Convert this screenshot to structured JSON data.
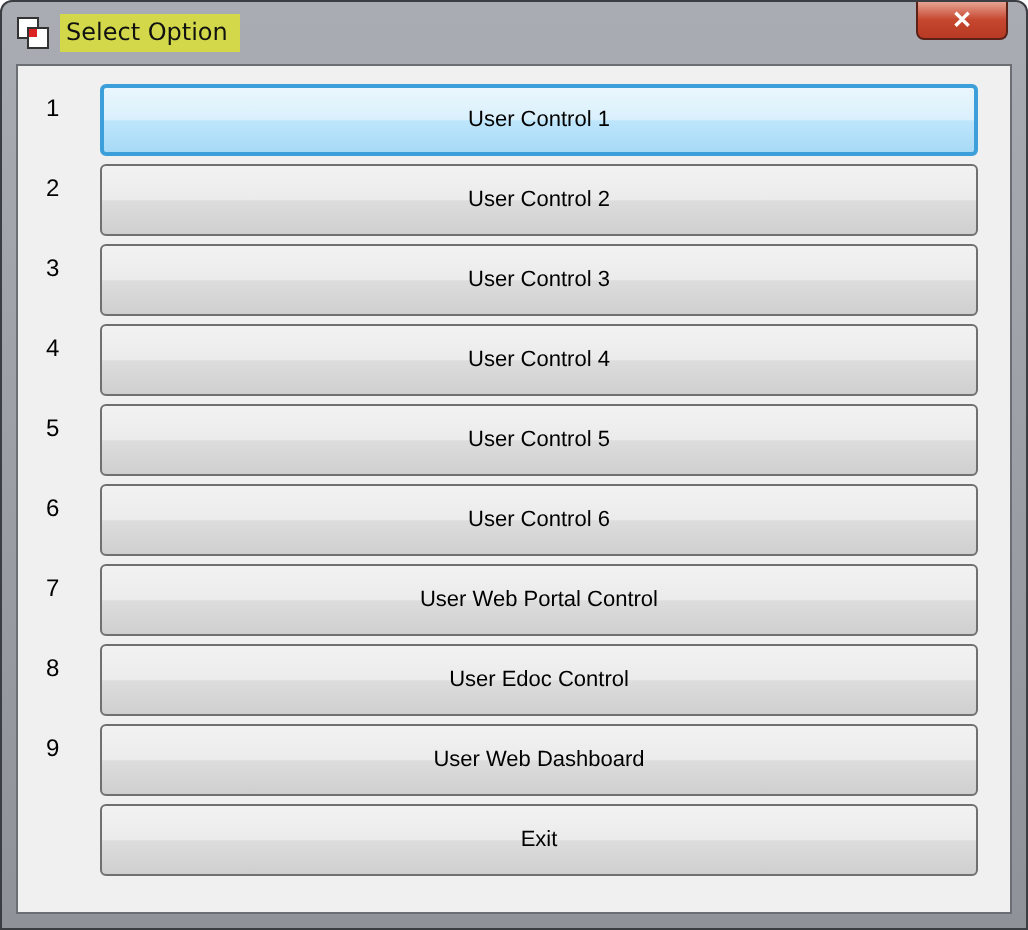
{
  "window": {
    "title": "Select Option",
    "close": "✕"
  },
  "options": [
    {
      "number": "1",
      "label": "User Control 1",
      "selected": true
    },
    {
      "number": "2",
      "label": "User Control 2",
      "selected": false
    },
    {
      "number": "3",
      "label": "User Control 3",
      "selected": false
    },
    {
      "number": "4",
      "label": "User Control 4",
      "selected": false
    },
    {
      "number": "5",
      "label": "User Control 5",
      "selected": false
    },
    {
      "number": "6",
      "label": "User Control 6",
      "selected": false
    },
    {
      "number": "7",
      "label": "User Web Portal Control",
      "selected": false
    },
    {
      "number": "8",
      "label": "User Edoc Control",
      "selected": false
    },
    {
      "number": "9",
      "label": "User Web Dashboard",
      "selected": false
    },
    {
      "label": "Exit",
      "selected": false
    }
  ]
}
